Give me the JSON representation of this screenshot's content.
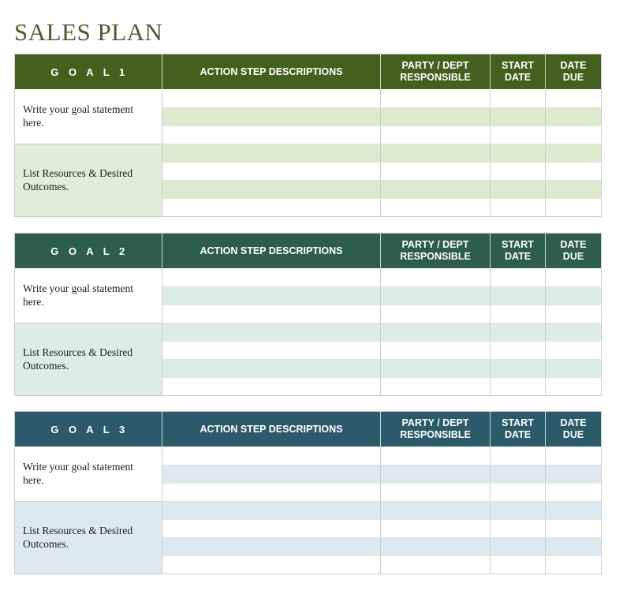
{
  "document": {
    "title": "SALES PLAN"
  },
  "columns": {
    "action": "ACTION STEP DESCRIPTIONS",
    "party": "PARTY / DEPT RESPONSIBLE",
    "party_line1": "PARTY / DEPT",
    "party_line2": "RESPONSIBLE",
    "start": "START DATE",
    "start_line1": "START",
    "start_line2": "DATE",
    "due": "DATE DUE",
    "due_line1": "DATE",
    "due_line2": "DUE"
  },
  "colors": {
    "title": "#4a5d32",
    "goal1_header": "#44601f",
    "goal1_stripe": "#ddeacd",
    "goal2_header": "#2e5c4d",
    "goal2_stripe": "#dcede8",
    "goal3_header": "#2d5a6b",
    "goal3_stripe": "#dce9f1",
    "grid_line": "#c9cfc6"
  },
  "goals": [
    {
      "label": "G O A L   1",
      "statement_prompt": "Write your goal statement here.",
      "resources_prompt": "List Resources & Desired Outcomes.",
      "rows": [
        {
          "action": "",
          "party": "",
          "start": "",
          "due": ""
        },
        {
          "action": "",
          "party": "",
          "start": "",
          "due": ""
        },
        {
          "action": "",
          "party": "",
          "start": "",
          "due": ""
        },
        {
          "action": "",
          "party": "",
          "start": "",
          "due": ""
        },
        {
          "action": "",
          "party": "",
          "start": "",
          "due": ""
        },
        {
          "action": "",
          "party": "",
          "start": "",
          "due": ""
        },
        {
          "action": "",
          "party": "",
          "start": "",
          "due": ""
        }
      ]
    },
    {
      "label": "G O A L   2",
      "statement_prompt": "Write your goal statement here.",
      "resources_prompt": "List Resources & Desired Outcomes.",
      "rows": [
        {
          "action": "",
          "party": "",
          "start": "",
          "due": ""
        },
        {
          "action": "",
          "party": "",
          "start": "",
          "due": ""
        },
        {
          "action": "",
          "party": "",
          "start": "",
          "due": ""
        },
        {
          "action": "",
          "party": "",
          "start": "",
          "due": ""
        },
        {
          "action": "",
          "party": "",
          "start": "",
          "due": ""
        },
        {
          "action": "",
          "party": "",
          "start": "",
          "due": ""
        },
        {
          "action": "",
          "party": "",
          "start": "",
          "due": ""
        }
      ]
    },
    {
      "label": "G O A L   3",
      "statement_prompt": "Write your goal statement here.",
      "resources_prompt": "List Resources & Desired Outcomes.",
      "rows": [
        {
          "action": "",
          "party": "",
          "start": "",
          "due": ""
        },
        {
          "action": "",
          "party": "",
          "start": "",
          "due": ""
        },
        {
          "action": "",
          "party": "",
          "start": "",
          "due": ""
        },
        {
          "action": "",
          "party": "",
          "start": "",
          "due": ""
        },
        {
          "action": "",
          "party": "",
          "start": "",
          "due": ""
        },
        {
          "action": "",
          "party": "",
          "start": "",
          "due": ""
        },
        {
          "action": "",
          "party": "",
          "start": "",
          "due": ""
        }
      ]
    }
  ]
}
